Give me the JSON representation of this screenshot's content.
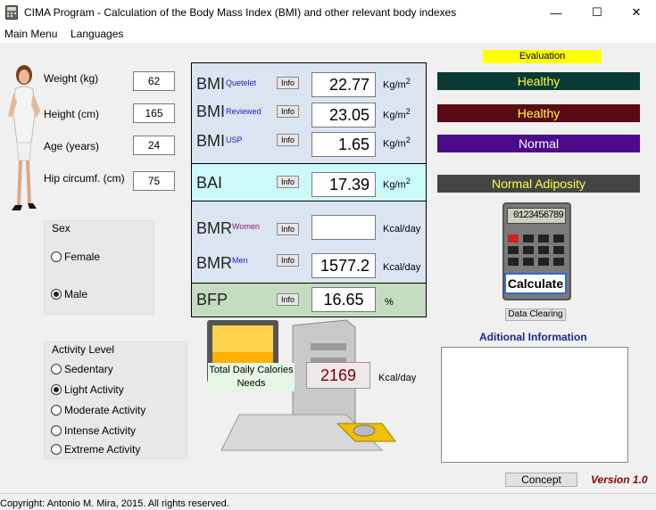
{
  "window": {
    "title": "CIMA Program - Calculation of the Body Mass Index (BMI) and other relevant body indexes",
    "minimize": "—",
    "maximize": "☐",
    "close": "✕"
  },
  "menu": {
    "main": "Main Menu",
    "languages": "Languages"
  },
  "inputs": {
    "weight_label": "Weight (kg)",
    "weight": "62",
    "height_label": "Height (cm)",
    "height": "165",
    "age_label": "Age (years)",
    "age": "24",
    "hip_label": "Hip circumf. (cm)",
    "hip": "75"
  },
  "sex": {
    "title": "Sex",
    "female": "Female",
    "male": "Male",
    "selected": "Male"
  },
  "activity": {
    "title": "Activity Level",
    "options": [
      "Sedentary",
      "Light Activity",
      "Moderate Activity",
      "Intense Activity",
      "Extreme Activity"
    ],
    "selected": "Light Activity"
  },
  "results": {
    "bmi": "BMI",
    "info": "Info",
    "quetelet": "Quetelet",
    "quetelet_val": "22.77",
    "reviewed": "Reviewed",
    "reviewed_val": "23.05",
    "usp": "USP",
    "usp_val": "1.65",
    "unit_kgm": "Kg/m",
    "sup2": "2",
    "bai": "BAI",
    "bai_val": "17.39",
    "bmr": "BMR",
    "women": "Women",
    "women_val": "",
    "men": "Men",
    "men_val": "1577.2",
    "unit_kcal": "Kcal/day",
    "bfp": "BFP",
    "bfp_val": "16.65",
    "unit_pct": "%"
  },
  "evaluation": {
    "title": "Evaluation",
    "bmi1": "Healthy",
    "bmi2": "Healthy",
    "bmi3": "Normal",
    "bai": "Normal Adiposity",
    "colors": {
      "bar1": "#0a3a32",
      "bar2": "#5a0a14",
      "bar3": "#4a0a8a",
      "bar4": "#444444",
      "title_bg": "#ffff00"
    }
  },
  "calculator": {
    "display": "0123456789",
    "calculate": "Calculate",
    "clear": "Data Clearing"
  },
  "calories": {
    "label": "Total Daily Calories Needs",
    "value": "2169",
    "unit": "Kcal/day"
  },
  "info_panel": {
    "title": "Aditional Information"
  },
  "footer": {
    "concept": "Concept",
    "version": "Version 1.0",
    "copyright": "Copyright: Antonio M. Mira, 2015. All rights reserved."
  }
}
